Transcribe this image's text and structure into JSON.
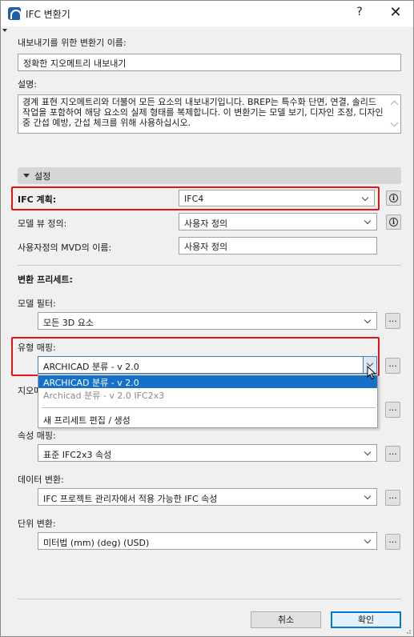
{
  "window": {
    "title": "IFC 변환기",
    "help_label": "?",
    "close_label": "✕"
  },
  "translator_name": {
    "label": "내보내기를 위한 변환기 이름:",
    "value": "정확한 지오메트리 내보내기"
  },
  "description": {
    "label": "설명:",
    "value": "경계 표현 지오메트리와 더불어 모든 요소의 내보내기입니다. BREP는 특수화 단면, 연결, 솔리드 작업을 포함하여 해당 요소의 실제 형태를 복제합니다. 이 변환기는 모델 보기, 디자인 조정, 디자인 중 간섭 예방, 간섭 체크를 위해 사용하십시오."
  },
  "settings_section": {
    "label": "설정"
  },
  "ifc_schema": {
    "label": "IFC 계획:",
    "value": "IFC4"
  },
  "model_view": {
    "label": "모델 뷰 정의:",
    "value": "사용자 정의"
  },
  "custom_mvd": {
    "label": "사용자정의 MVD의 이름:",
    "value": "사용자 정의"
  },
  "presets": {
    "heading": "변환 프리세트:",
    "model_filter": {
      "label": "모델 필터:",
      "value": "모든 3D 요소"
    },
    "type_mapping": {
      "label": "유형 매핑:",
      "value": "ARCHICAD 분류 - v 2.0",
      "options": [
        "ARCHICAD 분류 - v 2.0",
        "Archicad 분류 - v 2.0 IFC2x3",
        "새 프리세트 편집 / 생성"
      ]
    },
    "geometry_partial_label": "지오메",
    "property_mapping": {
      "label": "속성 매핑:",
      "value": "표준 IFC2x3 속성"
    },
    "data_conversion": {
      "label": "데이터 변환:",
      "value": "IFC 프로젝트 관리자에서 적용 가능한 IFC 속성"
    },
    "unit_conversion": {
      "label": "단위 변환:",
      "value": "미터법 (mm) (deg) (USD)"
    },
    "dots_label": "..."
  },
  "buttons": {
    "cancel": "취소",
    "ok": "확인"
  },
  "info_glyph": "i",
  "colors": {
    "highlight": "#e3141b",
    "selection": "#1470c8"
  }
}
